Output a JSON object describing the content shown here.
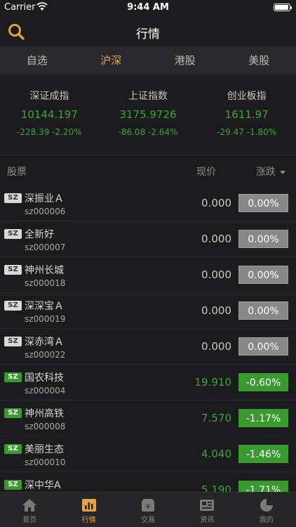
{
  "status_bar": {
    "carrier": "Carrier",
    "time": "9:44 AM"
  },
  "nav": {
    "title": "行情",
    "search_icon": "search-icon"
  },
  "market_tabs": [
    {
      "label": "自选",
      "active": false
    },
    {
      "label": "沪深",
      "active": true
    },
    {
      "label": "港股",
      "active": false
    },
    {
      "label": "美股",
      "active": false
    }
  ],
  "indices": [
    {
      "name": "深证成指",
      "value": "10144.197",
      "change": "-228.39",
      "percent": "-2.20%"
    },
    {
      "name": "上证指数",
      "value": "3175.9726",
      "change": "-86.08",
      "percent": "-2.64%"
    },
    {
      "name": "创业板指",
      "value": "1611.97",
      "change": "-29.47",
      "percent": "-1.80%"
    }
  ],
  "list_header": {
    "stock": "股票",
    "price": "现价",
    "change": "涨跌"
  },
  "stocks": [
    {
      "market": "SZ",
      "name": "深振业Ａ",
      "code": "sz000006",
      "price": "0.000",
      "change": "0.00%",
      "trend": "flat"
    },
    {
      "market": "SZ",
      "name": "全新好",
      "code": "sz000007",
      "price": "0.000",
      "change": "0.00%",
      "trend": "flat"
    },
    {
      "market": "SZ",
      "name": "神州长城",
      "code": "sz000018",
      "price": "0.000",
      "change": "0.00%",
      "trend": "flat"
    },
    {
      "market": "SZ",
      "name": "深深宝Ａ",
      "code": "sz000019",
      "price": "0.000",
      "change": "0.00%",
      "trend": "flat"
    },
    {
      "market": "SZ",
      "name": "深赤湾Ａ",
      "code": "sz000022",
      "price": "0.000",
      "change": "0.00%",
      "trend": "flat"
    },
    {
      "market": "SZ",
      "name": "国农科技",
      "code": "sz000004",
      "price": "19.910",
      "change": "-0.60%",
      "trend": "down"
    },
    {
      "market": "SZ",
      "name": "神州高铁",
      "code": "sz000008",
      "price": "7.570",
      "change": "-1.17%",
      "trend": "down"
    },
    {
      "market": "SZ",
      "name": "美丽生态",
      "code": "sz000010",
      "price": "4.040",
      "change": "-1.46%",
      "trend": "down"
    },
    {
      "market": "SZ",
      "name": "深中华A",
      "code": "",
      "price": "5.190",
      "change": "-1.71%",
      "trend": "down"
    }
  ],
  "tab_bar": [
    {
      "label": "首页",
      "icon": "home-icon",
      "active": false
    },
    {
      "label": "行情",
      "icon": "chart-icon",
      "active": true
    },
    {
      "label": "交易",
      "icon": "trade-icon",
      "active": false
    },
    {
      "label": "资讯",
      "icon": "news-icon",
      "active": false
    },
    {
      "label": "我的",
      "icon": "profile-icon",
      "active": false
    }
  ],
  "colors": {
    "accent": "#e4a340",
    "down": "#3fa33a",
    "flat_badge": "#888888",
    "background": "#1c1c1e"
  }
}
